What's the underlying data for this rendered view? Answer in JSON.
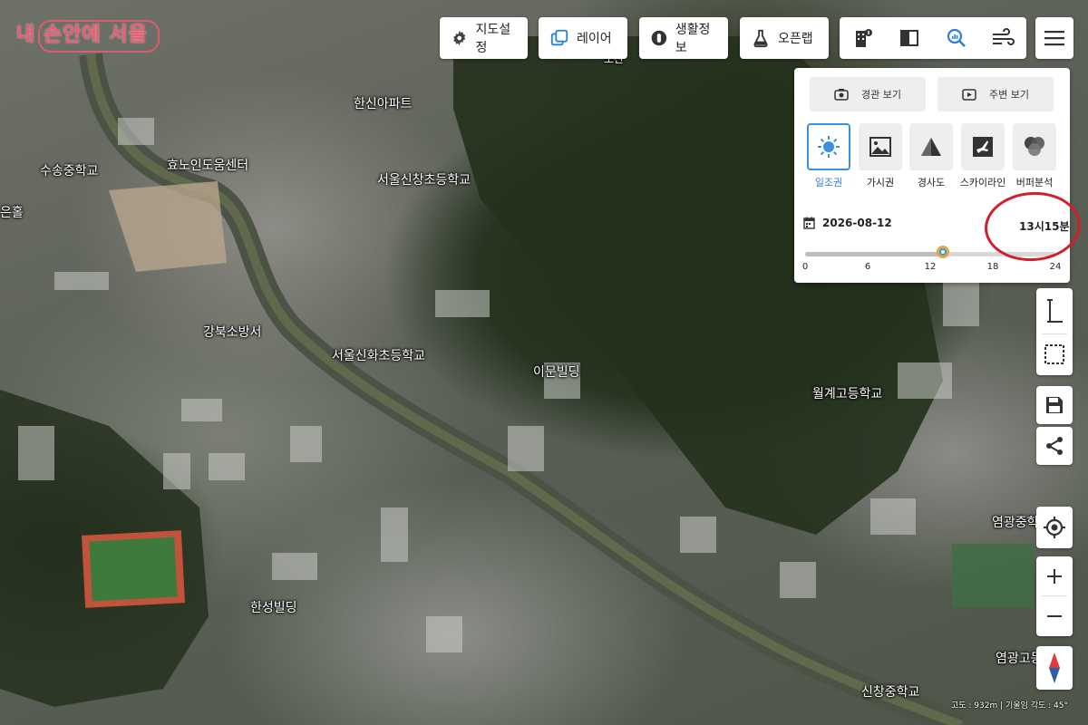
{
  "logo": {
    "text": "내 손안에 서울"
  },
  "toolbar": {
    "map_settings": "지도설정",
    "layers": "레이어",
    "life_info": "생활정보",
    "openlab": "오픈랩"
  },
  "panel": {
    "landscape_view": "경관 보기",
    "surround_view": "주변 보기",
    "tools": [
      {
        "label": "일조권",
        "icon": "sun-icon",
        "active": true
      },
      {
        "label": "가시권",
        "icon": "image-icon",
        "active": false
      },
      {
        "label": "경사도",
        "icon": "slope-icon",
        "active": false
      },
      {
        "label": "스카이라인",
        "icon": "skyline-icon",
        "active": false
      },
      {
        "label": "버퍼분석",
        "icon": "buffer-icon",
        "active": false
      }
    ],
    "date": "2026-08-12",
    "time": "13시15분",
    "slider": {
      "min": 0,
      "max": 24,
      "value": 13.25,
      "ticks": [
        "0",
        "6",
        "12",
        "18",
        "24"
      ]
    }
  },
  "map_labels": [
    "수송중학교",
    "효노인도움센터",
    "한신아파트",
    "서울신창초등학교",
    "은홀",
    "강북소방서",
    "서울신화초등학교",
    "이문빌딩",
    "월계고등학교",
    "한성빌딩",
    "신창중학교",
    "염광중학",
    "염광고등",
    "도산"
  ],
  "status": {
    "altitude": "고도 : 932m",
    "tilt": "기울임 각도 : 45°"
  },
  "colors": {
    "accent": "#3b8fe0",
    "highlight": "#d21f2a",
    "logo": "#f05a70"
  }
}
